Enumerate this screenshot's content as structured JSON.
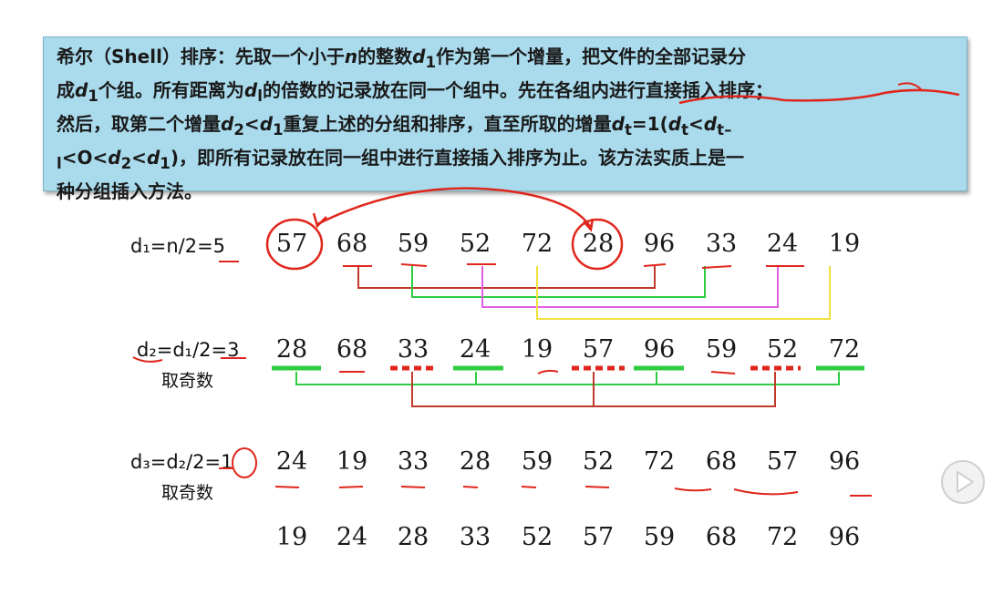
{
  "description": {
    "line1_a": "希尔（",
    "line1_b": "Shell",
    "line1_c": "）排序：先取一个小于",
    "line1_n": "n",
    "line1_d": "的整数",
    "line1_var": "d",
    "line1_sub": "1",
    "line1_e": "作为第一个增量，把文件的全部记录分",
    "line2_a": "成",
    "line2_var": "d",
    "line2_sub": "1",
    "line2_b": "个组。所有距离为",
    "line2_var2": "d",
    "line2_sub2": "l",
    "line2_c": "的倍数的记录放在同一个组中。先在各组内进行直接插入排序；",
    "line3_a": "然后，取第二个增量",
    "line3_d2": "d",
    "line3_sub2": "2",
    "line3_lt": "<",
    "line3_d1": "d",
    "line3_sub1": "1",
    "line3_b": "重复上述的分组和排序，直至所取的增量",
    "line3_dt": "d",
    "line3_subt": "t",
    "line3_c": "=1(",
    "line3_dt2": "d",
    "line3_subt2": "t",
    "line3_lt2": "<",
    "line3_dt3": "d",
    "line3_subt3": "t–",
    "line4_sub": "l",
    "line4_a": "<O<",
    "line4_d2": "d",
    "line4_sub2": "2",
    "line4_lt": "<",
    "line4_d1": "d",
    "line4_sub1": "1",
    "line4_b": ")，即所有记录放在同一组中进行直接插入排序为止。该方法实质上是一",
    "line5": "种分组插入方法。"
  },
  "step1": {
    "label": "d₁=n/2=5",
    "values": [
      "57",
      "68",
      "59",
      "52",
      "72",
      "28",
      "96",
      "33",
      "24",
      "19"
    ]
  },
  "step2": {
    "label": "d₂=d₁/2=3",
    "sublabel": "取奇数",
    "values": [
      "28",
      "68",
      "33",
      "24",
      "19",
      "57",
      "96",
      "59",
      "52",
      "72"
    ]
  },
  "step3": {
    "label": "d₃=d₂/2=1",
    "sublabel": "取奇数",
    "values": [
      "24",
      "19",
      "33",
      "28",
      "59",
      "52",
      "72",
      "68",
      "57",
      "96"
    ]
  },
  "final": {
    "values": [
      "19",
      "24",
      "28",
      "33",
      "52",
      "57",
      "59",
      "68",
      "72",
      "96"
    ]
  },
  "colors": {
    "box_bg": "#a9dbed",
    "annotation_red": "#e0261c",
    "group_green": "#2ecc40",
    "group_magenta": "#e060e0",
    "group_yellow": "#f0e040",
    "group_red": "#c0392b"
  },
  "player": {
    "icon": "play-icon"
  }
}
